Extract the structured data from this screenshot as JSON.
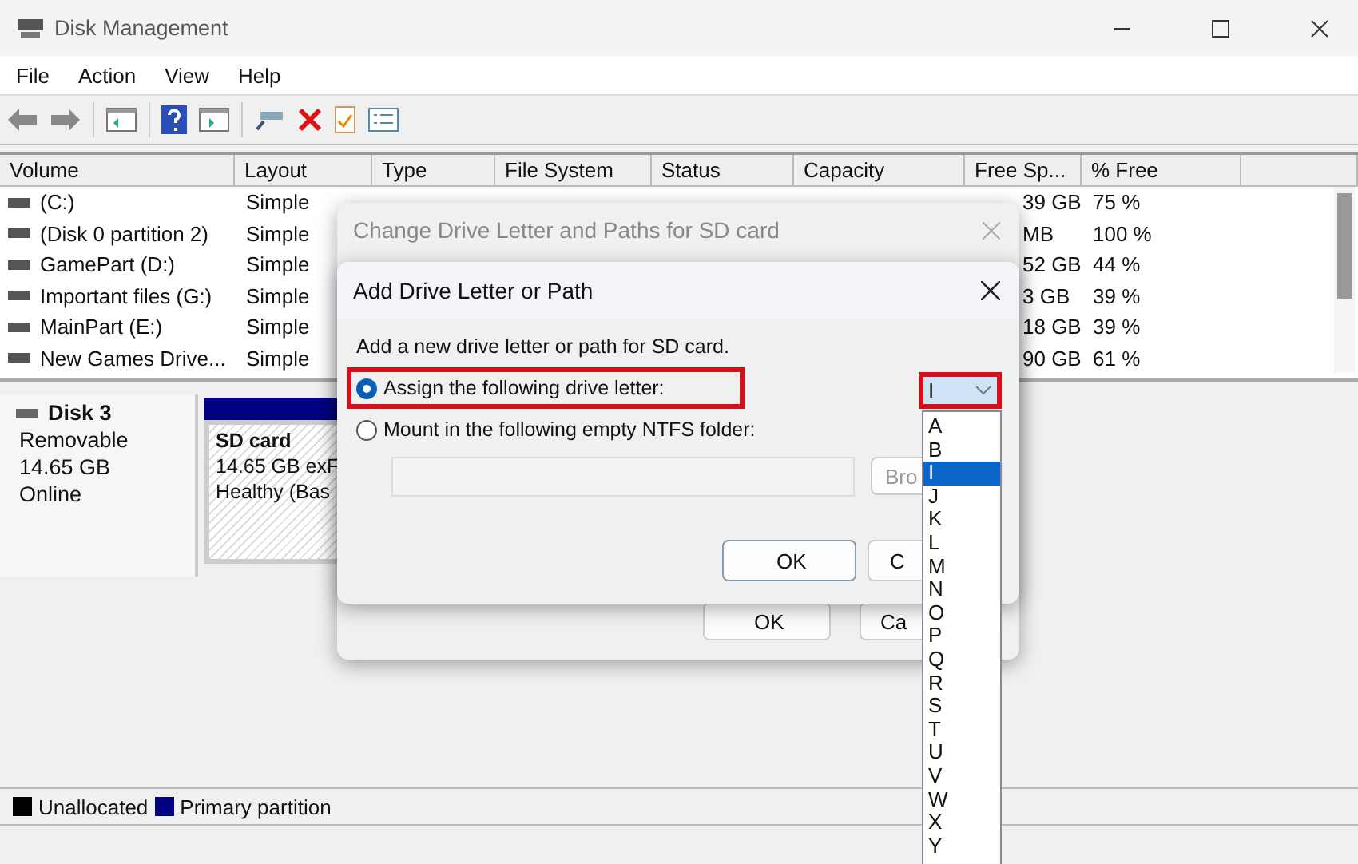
{
  "window": {
    "title": "Disk Management"
  },
  "menu": [
    "File",
    "Action",
    "View",
    "Help"
  ],
  "table": {
    "columns": [
      "Volume",
      "Layout",
      "Type",
      "File System",
      "Status",
      "Capacity",
      "Free Sp...",
      "% Free"
    ],
    "rows": [
      {
        "volume": "(C:)",
        "layout": "Simple",
        "free_space": "39 GB",
        "percent_free": "75 %"
      },
      {
        "volume": "(Disk 0 partition 2)",
        "layout": "Simple",
        "free_space": "MB",
        "percent_free": "100 %"
      },
      {
        "volume": "GamePart (D:)",
        "layout": "Simple",
        "free_space": "52 GB",
        "percent_free": "44 %"
      },
      {
        "volume": "Important files (G:)",
        "layout": "Simple",
        "free_space": "3 GB",
        "percent_free": "39 %"
      },
      {
        "volume": "MainPart (E:)",
        "layout": "Simple",
        "free_space": "18 GB",
        "percent_free": "39 %"
      },
      {
        "volume": "New Games Drive...",
        "layout": "Simple",
        "free_space": "90 GB",
        "percent_free": "61 %"
      }
    ]
  },
  "disk": {
    "name": "Disk 3",
    "type": "Removable",
    "size": "14.65 GB",
    "state": "Online"
  },
  "partition": {
    "name": "SD card",
    "size": "14.65 GB exF",
    "status": "Healthy (Bas"
  },
  "legend": [
    {
      "label": "Unallocated",
      "color": "#000000"
    },
    {
      "label": "Primary partition",
      "color": "#000080"
    }
  ],
  "outer_dialog": {
    "title": "Change Drive Letter and Paths for SD card",
    "buttons": [
      "OK",
      "Ca"
    ]
  },
  "inner_dialog": {
    "title": "Add Drive Letter or Path",
    "prompt": "Add a new drive letter or path for SD card.",
    "options": [
      {
        "label": "Assign the following drive letter:",
        "selected": true
      },
      {
        "label": "Mount in the following empty NTFS folder:",
        "selected": false
      }
    ],
    "browse_button": "Bro",
    "buttons": [
      "OK",
      "C"
    ],
    "drive_letter": {
      "value": "I",
      "list": [
        {
          "letter": "A",
          "selected": false
        },
        {
          "letter": "B",
          "selected": false
        },
        {
          "letter": "I",
          "selected": true
        },
        {
          "letter": "J",
          "selected": false
        },
        {
          "letter": "K",
          "selected": false
        },
        {
          "letter": "L",
          "selected": false
        },
        {
          "letter": "M",
          "selected": false
        },
        {
          "letter": "N",
          "selected": false
        },
        {
          "letter": "O",
          "selected": false
        },
        {
          "letter": "P",
          "selected": false
        },
        {
          "letter": "Q",
          "selected": false
        },
        {
          "letter": "R",
          "selected": false
        },
        {
          "letter": "S",
          "selected": false
        },
        {
          "letter": "T",
          "selected": false
        },
        {
          "letter": "U",
          "selected": false
        },
        {
          "letter": "V",
          "selected": false
        },
        {
          "letter": "W",
          "selected": false
        },
        {
          "letter": "X",
          "selected": false
        },
        {
          "letter": "Y",
          "selected": false
        }
      ]
    }
  }
}
